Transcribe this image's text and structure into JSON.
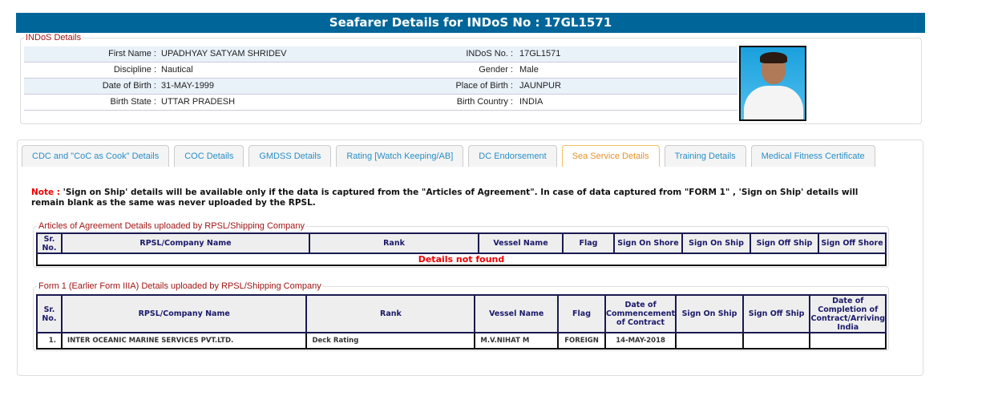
{
  "header": {
    "title": "Seafarer Details for INDoS No : 17GL1571"
  },
  "indos": {
    "legend": "INDoS Details",
    "rows": [
      {
        "l1": "First Name :",
        "v1": "UPADHYAY SATYAM SHRIDEV",
        "l2": "INDoS No. :",
        "v2": "17GL1571"
      },
      {
        "l1": "Discipline :",
        "v1": "Nautical",
        "l2": "Gender :",
        "v2": "Male"
      },
      {
        "l1": "Date of Birth :",
        "v1": "31-MAY-1999",
        "l2": "Place of Birth :",
        "v2": "JAUNPUR"
      },
      {
        "l1": "Birth State :",
        "v1": "UTTAR PRADESH",
        "l2": "Birth Country :",
        "v2": "INDIA"
      }
    ]
  },
  "tabs": [
    "CDC and \"CoC as Cook\" Details",
    "COC Details",
    "GMDSS Details",
    "Rating [Watch Keeping/AB]",
    "DC Endorsement",
    "Sea Service Details",
    "Training Details",
    "Medical Fitness Certificate"
  ],
  "active_tab": "Sea Service Details",
  "note": {
    "label": "Note :",
    "text": " 'Sign on Ship' details will be available only if the data is captured from the \"Articles of Agreement\". In case of data captured from \"FORM 1\" , 'Sign on Ship' details will remain blank as the same was never uploaded by the RPSL."
  },
  "articles": {
    "legend": "Articles of Agreement Details uploaded by RPSL/Shipping Company",
    "columns": [
      "Sr. No.",
      "RPSL/Company Name",
      "Rank",
      "Vessel Name",
      "Flag",
      "Sign On Shore",
      "Sign On Ship",
      "Sign Off Ship",
      "Sign Off Shore"
    ],
    "empty": "Details not found"
  },
  "form1": {
    "legend": "Form 1 (Earlier Form IIIA) Details uploaded by RPSL/Shipping Company",
    "columns": [
      "Sr. No.",
      "RPSL/Company Name",
      "Rank",
      "Vessel Name",
      "Flag",
      "Date of Commencement of Contract",
      "Sign On Ship",
      "Sign Off Ship",
      "Date of Completion of Contract/Arriving India"
    ],
    "rows": [
      [
        "1.",
        "INTER OCEANIC MARINE SERVICES PVT.LTD.",
        "Deck Rating",
        "M.V.NIHAT M",
        "FOREIGN",
        "14-MAY-2018",
        "",
        "",
        ""
      ]
    ]
  },
  "colors": {
    "header": "#00669a",
    "legend": "#a01515",
    "tab_text": "#2a8fc5",
    "active_tab": "#e5922a"
  }
}
